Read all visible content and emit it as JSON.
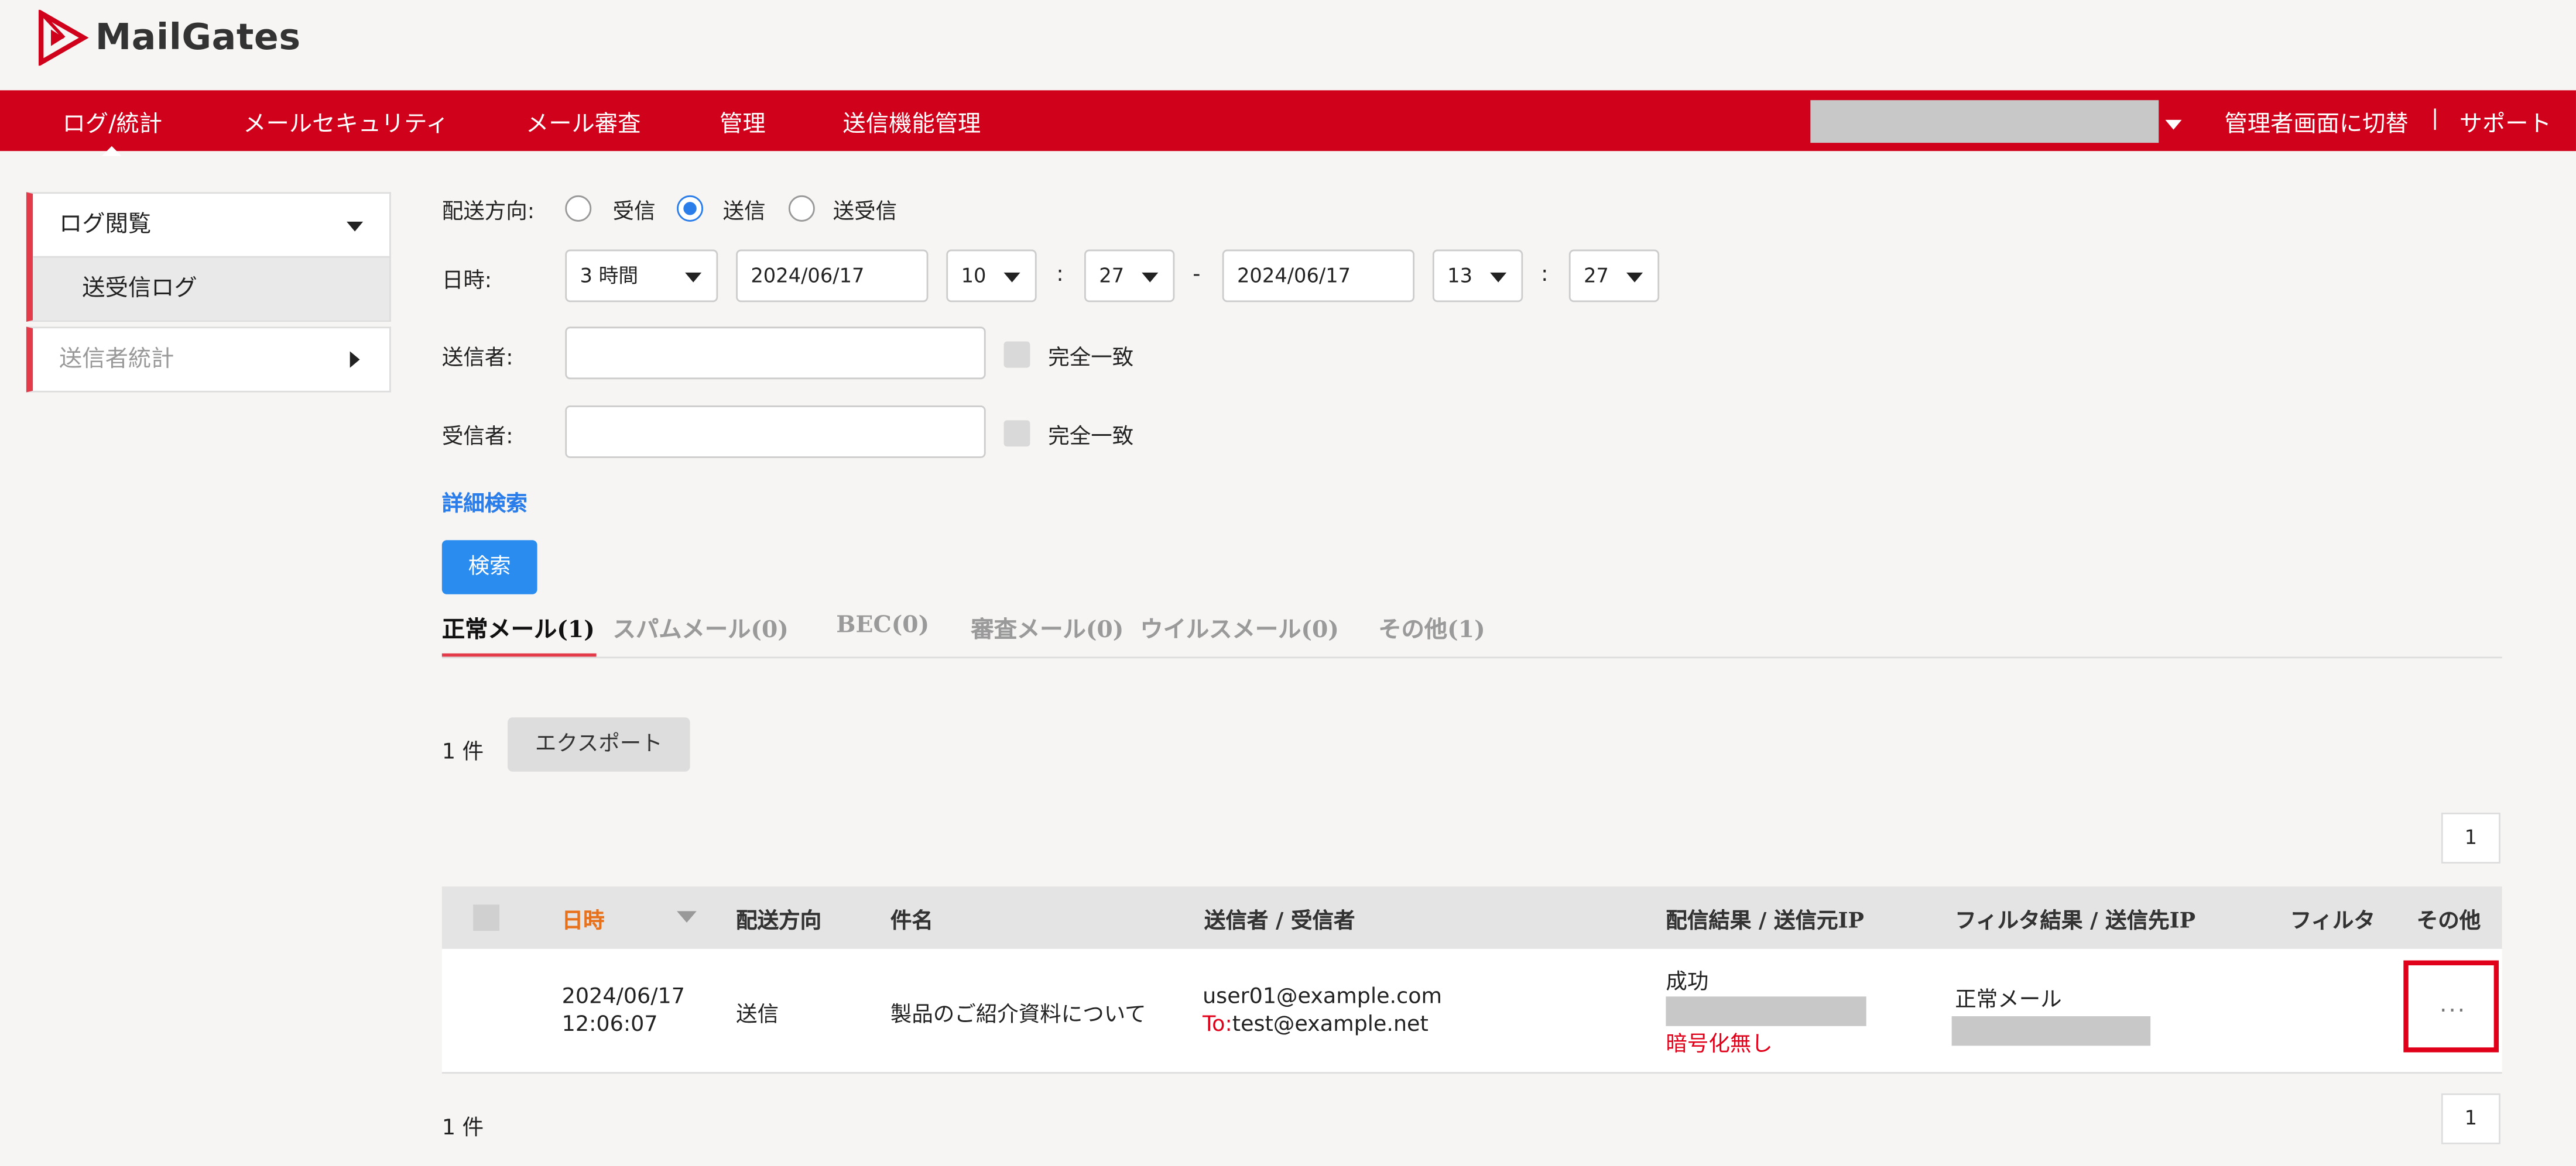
{
  "app": {
    "name": "MailGates"
  },
  "nav": {
    "items": [
      "ログ/統計",
      "メールセキュリティ",
      "メール審査",
      "管理",
      "送信機能管理"
    ],
    "switch_admin": "管理者画面に切替",
    "separator": "|",
    "support": "サポート"
  },
  "sidebar": {
    "section1": "ログ閲覧",
    "section1_sub": "送受信ログ",
    "section2": "送信者統計"
  },
  "form": {
    "direction_label": "配送方向:",
    "direction_options": [
      "受信",
      "送信",
      "送受信"
    ],
    "direction_selected": "送信",
    "datetime_label": "日時:",
    "range": "3 時間",
    "from_date": "2024/06/17",
    "from_hour": "10",
    "from_min": "27",
    "to_date": "2024/06/17",
    "to_hour": "13",
    "to_min": "27",
    "colon": ":",
    "dash": "-",
    "sender_label": "送信者:",
    "recipient_label": "受信者:",
    "exact_match": "完全一致",
    "advanced_search": "詳細検索",
    "search_button": "検索"
  },
  "tabs": [
    "正常メール(1)",
    "スパムメール(0)",
    "BEC(0)",
    "審査メール(0)",
    "ウイルスメール(0)",
    "その他(1)"
  ],
  "results": {
    "count": "1 件",
    "export_button": "エクスポート",
    "page": "1"
  },
  "table": {
    "headers": {
      "datetime": "日時",
      "direction": "配送方向",
      "subject": "件名",
      "sender_recipient": "送信者 / 受信者",
      "delivery_result": "配信結果 / 送信元IP",
      "filter_result": "フィルタ結果 / 送信先IP",
      "filter": "フィルタ",
      "other": "その他"
    },
    "rows": [
      {
        "date": "2024/06/17",
        "time": "12:06:07",
        "direction": "送信",
        "subject": "製品のご紹介資料について",
        "sender": "user01@example.com",
        "to_prefix": "To:",
        "recipient": "test@example.net",
        "delivery": "成功",
        "encryption": "暗号化無し",
        "filter_result": "正常メール",
        "more": "···"
      }
    ]
  },
  "colors": {
    "brand_red": "#d0021b",
    "accent_blue": "#2b8cf0",
    "sort_orange": "#e8721c"
  }
}
